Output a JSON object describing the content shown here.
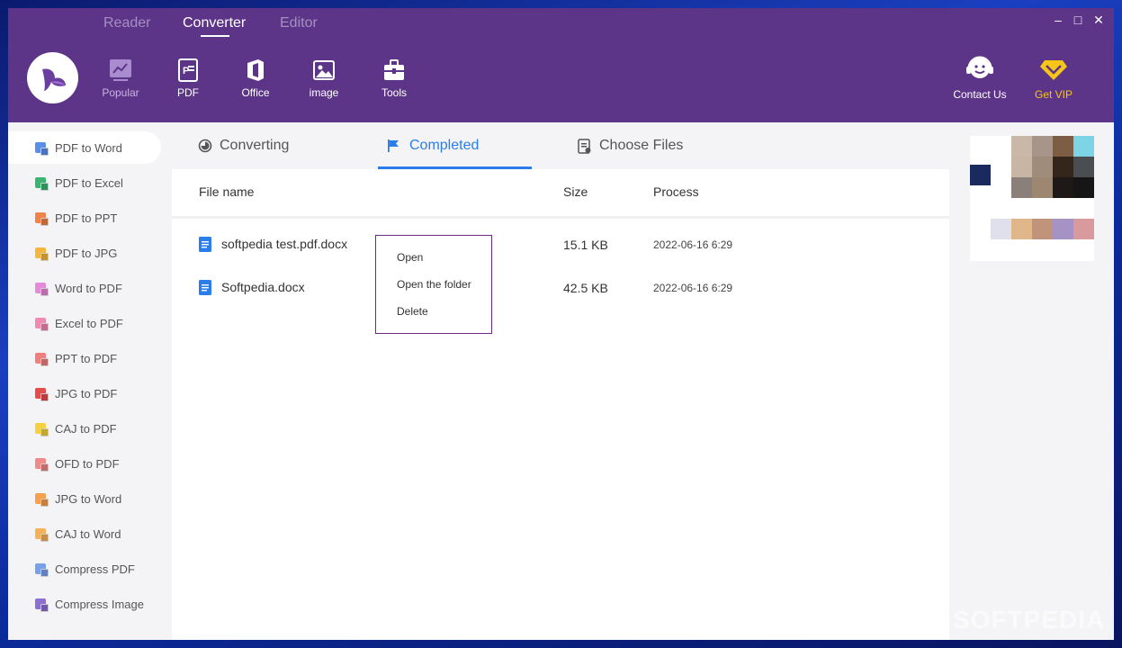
{
  "top_tabs": [
    {
      "label": "Reader"
    },
    {
      "label": "Converter"
    },
    {
      "label": "Editor"
    }
  ],
  "categories": [
    {
      "label": "Popular",
      "icon": "chart-icon"
    },
    {
      "label": "PDF",
      "icon": "pdf-icon"
    },
    {
      "label": "Office",
      "icon": "office-icon"
    },
    {
      "label": "image",
      "icon": "image-icon"
    },
    {
      "label": "Tools",
      "icon": "toolbox-icon"
    }
  ],
  "header_right": {
    "contact_label": "Contact Us",
    "vip_label": "Get VIP"
  },
  "window_controls": {
    "minimize": "–",
    "maximize": "□",
    "close": "✕"
  },
  "sidebar": {
    "items": [
      {
        "label": "PDF to Word",
        "color": "#5b8ee8"
      },
      {
        "label": "PDF to Excel",
        "color": "#3cb371"
      },
      {
        "label": "PDF to PPT",
        "color": "#f0834a"
      },
      {
        "label": "PDF to JPG",
        "color": "#f4b63d"
      },
      {
        "label": "Word to PDF",
        "color": "#e58ad6"
      },
      {
        "label": "Excel to PDF",
        "color": "#ef8ab0"
      },
      {
        "label": "PPT to PDF",
        "color": "#ef7f7f"
      },
      {
        "label": "JPG to PDF",
        "color": "#e34d4d"
      },
      {
        "label": "CAJ to PDF",
        "color": "#f4d13d"
      },
      {
        "label": "OFD to PDF",
        "color": "#ef8a8a"
      },
      {
        "label": "JPG to Word",
        "color": "#f6a04d"
      },
      {
        "label": "CAJ to Word",
        "color": "#f6b25a"
      },
      {
        "label": "Compress PDF",
        "color": "#7aa0e8"
      },
      {
        "label": "Compress Image",
        "color": "#8c6fd1"
      }
    ]
  },
  "main_tabs": [
    {
      "label": "Converting",
      "icon": "clock-icon"
    },
    {
      "label": "Completed",
      "icon": "flag-icon"
    },
    {
      "label": "Choose Files",
      "icon": "file-list-icon"
    }
  ],
  "table": {
    "headers": {
      "name": "File name",
      "size": "Size",
      "process": "Process"
    },
    "rows": [
      {
        "name": "softpedia test.pdf.docx",
        "size": "15.1 KB",
        "date": "2022-06-16  6:29"
      },
      {
        "name": "Softpedia.docx",
        "size": "42.5 KB",
        "date": "2022-06-16  6:29"
      }
    ]
  },
  "context_menu": {
    "items": [
      {
        "label": "Open"
      },
      {
        "label": "Open the folder"
      },
      {
        "label": "Delete"
      }
    ]
  },
  "watermark": "SOFTPEDIA",
  "colors": {
    "brand_purple": "#5d3588",
    "accent_blue": "#2b7de9",
    "vip_gold": "#f5c518"
  }
}
